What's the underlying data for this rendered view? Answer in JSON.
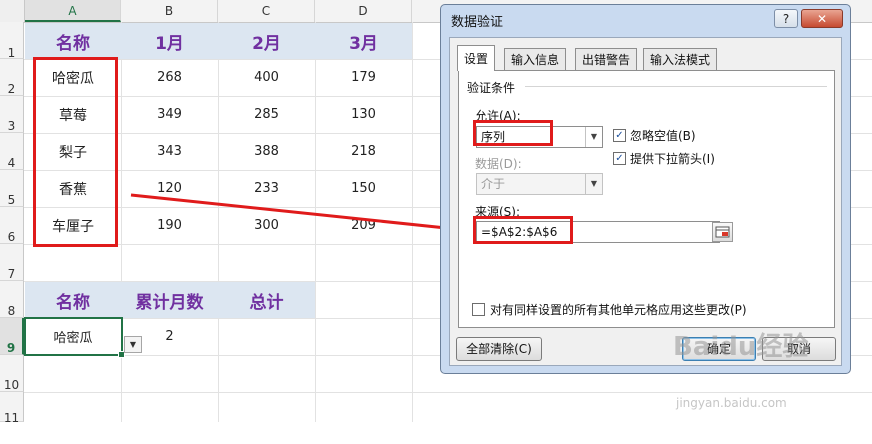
{
  "columns": [
    "A",
    "B",
    "C",
    "D"
  ],
  "rows": [
    "1",
    "2",
    "3",
    "4",
    "5",
    "6",
    "7",
    "8",
    "9",
    "10",
    "11"
  ],
  "table1": {
    "headers": [
      "名称",
      "1月",
      "2月",
      "3月"
    ],
    "rows": [
      [
        "哈密瓜",
        "268",
        "400",
        "179"
      ],
      [
        "草莓",
        "349",
        "285",
        "130"
      ],
      [
        "梨子",
        "343",
        "388",
        "218"
      ],
      [
        "香蕉",
        "120",
        "233",
        "150"
      ],
      [
        "车厘子",
        "190",
        "300",
        "209"
      ]
    ]
  },
  "table2": {
    "headers": [
      "名称",
      "累计月数",
      "总计"
    ],
    "row": [
      "哈密瓜",
      "2"
    ]
  },
  "dialog": {
    "title": "数据验证",
    "help_btn": "?",
    "close_btn": "✕",
    "tabs": [
      "设置",
      "输入信息",
      "出错警告",
      "输入法模式"
    ],
    "section": "验证条件",
    "allow_label": "允许(A):",
    "allow_value": "序列",
    "ignore_blank": "忽略空值(B)",
    "dropdown_arrow": "提供下拉箭头(I)",
    "data_label": "数据(D):",
    "data_value": "介于",
    "source_label": "来源(S):",
    "source_value": "=$A$2:$A$6",
    "apply_all": "对有同样设置的所有其他单元格应用这些更改(P)",
    "clear_all": "全部清除(C)",
    "ok": "确定",
    "cancel": "取消"
  },
  "watermark": {
    "logo": "Baidu经验",
    "url": "jingyan.baidu.com"
  },
  "colors": {
    "header_fill": "#dce6f1",
    "header_text": "#7030a0",
    "highlight": "#e01b1b",
    "selection": "#217346"
  }
}
